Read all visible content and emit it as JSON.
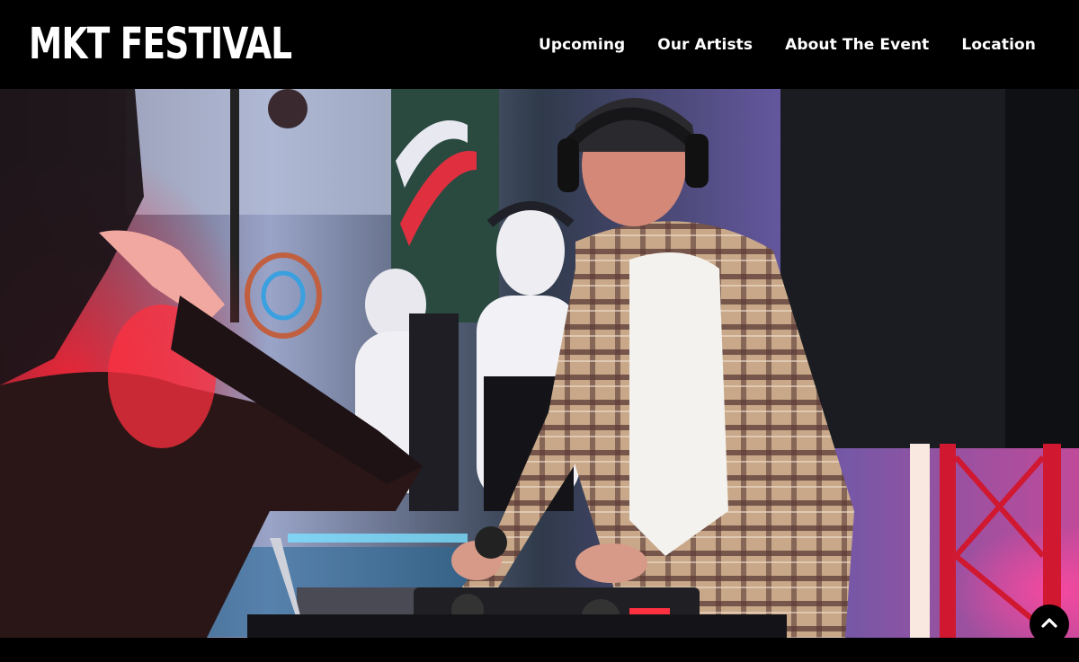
{
  "header": {
    "logo": "MKT FESTIVAL",
    "nav": [
      {
        "label": "Upcoming"
      },
      {
        "label": "Our Artists"
      },
      {
        "label": "About The Event"
      },
      {
        "label": "Location"
      }
    ]
  },
  "hero": {
    "image": "dj-performing-at-turntable-photo"
  },
  "scroll_top": {
    "icon": "chevron-up-icon"
  }
}
